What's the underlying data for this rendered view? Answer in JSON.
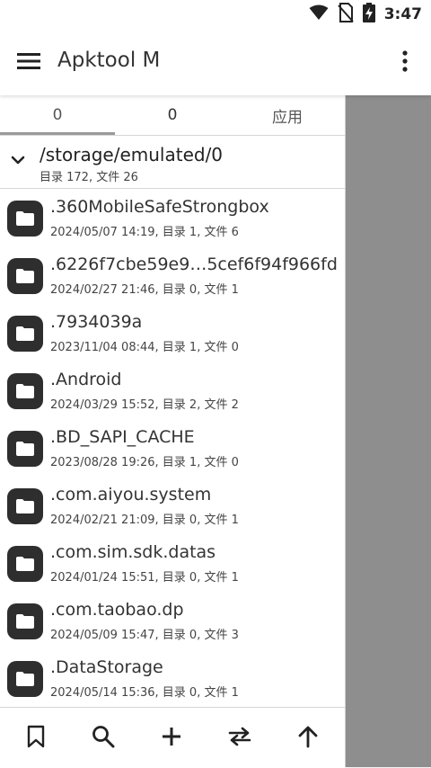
{
  "status_bar": {
    "time": "3:47",
    "icons": [
      "wifi-icon",
      "no-sim-icon",
      "battery-charging-icon"
    ]
  },
  "app_bar": {
    "title": "Apktool M",
    "icons": [
      "menu-icon",
      "more-vert-icon"
    ]
  },
  "drawer": {
    "tabs": [
      {
        "label": "0",
        "selected": true
      },
      {
        "label": "0",
        "selected": false
      },
      {
        "label": "应用",
        "selected": false
      }
    ],
    "path": {
      "title": "/storage/emulated/0",
      "subtitle": "目录 172, 文件 26"
    },
    "files": [
      {
        "name": ".360MobileSafeStrongbox",
        "meta": "2024/05/07 14:19, 目录 1, 文件 6"
      },
      {
        "name": ".6226f7cbe59e9…5cef6f94f966fd",
        "meta": "2024/02/27 21:46, 目录 0, 文件 1"
      },
      {
        "name": ".7934039a",
        "meta": "2023/11/04 08:44, 目录 1, 文件 0"
      },
      {
        "name": ".Android",
        "meta": "2024/03/29 15:52, 目录 2, 文件 2"
      },
      {
        "name": ".BD_SAPI_CACHE",
        "meta": "2023/08/28 19:26, 目录 1, 文件 0"
      },
      {
        "name": ".com.aiyou.system",
        "meta": "2024/02/21 21:09, 目录 0, 文件 1"
      },
      {
        "name": ".com.sim.sdk.datas",
        "meta": "2024/01/24 15:51, 目录 0, 文件 1"
      },
      {
        "name": ".com.taobao.dp",
        "meta": "2024/05/09 15:47, 目录 0, 文件 3"
      },
      {
        "name": ".DataStorage",
        "meta": "2024/05/14 15:36, 目录 0, 文件 1"
      }
    ],
    "bottom_bar": [
      "bookmark-icon",
      "search-icon",
      "add-icon",
      "swap-icon",
      "arrow-up-icon"
    ]
  },
  "colors": {
    "folder_tile": "#2e2e2e",
    "scrim": "#8e8e8e",
    "tab_indicator": "#9a9a9a"
  }
}
